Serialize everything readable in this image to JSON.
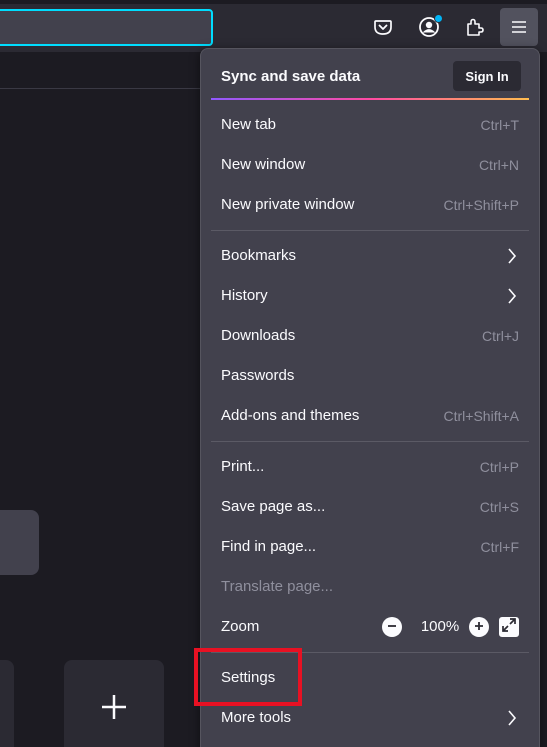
{
  "toolbar": {
    "icons": [
      "pocket-icon",
      "account-icon",
      "extensions-icon",
      "hamburger-menu-icon"
    ]
  },
  "menu": {
    "sync_title": "Sync and save data",
    "sign_in": "Sign In",
    "new_tab": {
      "label": "New tab",
      "shortcut": "Ctrl+T"
    },
    "new_window": {
      "label": "New window",
      "shortcut": "Ctrl+N"
    },
    "new_private_window": {
      "label": "New private window",
      "shortcut": "Ctrl+Shift+P"
    },
    "bookmarks": {
      "label": "Bookmarks"
    },
    "history": {
      "label": "History"
    },
    "downloads": {
      "label": "Downloads",
      "shortcut": "Ctrl+J"
    },
    "passwords": {
      "label": "Passwords"
    },
    "addons": {
      "label": "Add-ons and themes",
      "shortcut": "Ctrl+Shift+A"
    },
    "print": {
      "label": "Print...",
      "shortcut": "Ctrl+P"
    },
    "save_page": {
      "label": "Save page as...",
      "shortcut": "Ctrl+S"
    },
    "find": {
      "label": "Find in page...",
      "shortcut": "Ctrl+F"
    },
    "translate": {
      "label": "Translate page..."
    },
    "zoom": {
      "label": "Zoom",
      "value": "100%"
    },
    "settings": {
      "label": "Settings"
    },
    "more_tools": {
      "label": "More tools"
    }
  },
  "colors": {
    "highlight": "#e81123",
    "accent": "#00ddff"
  }
}
